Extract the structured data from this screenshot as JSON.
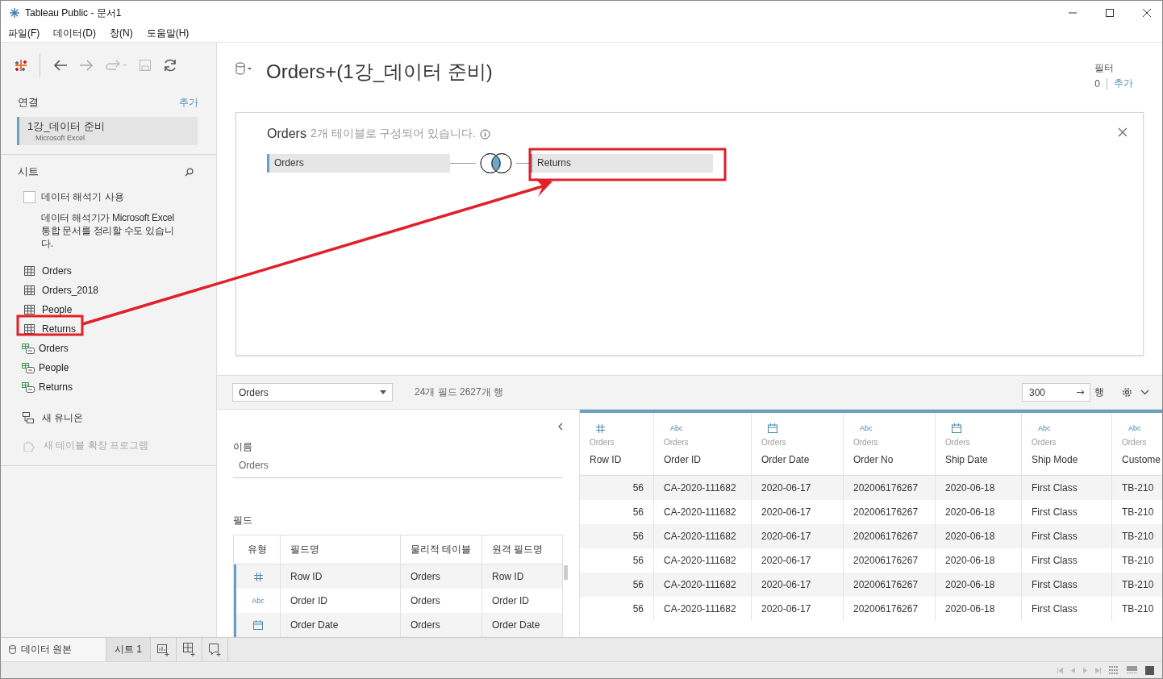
{
  "window": {
    "title": "Tableau Public - 문서1"
  },
  "menu": [
    "파일(F)",
    "데이터(D)",
    "창(N)",
    "도움말(H)"
  ],
  "sidebar": {
    "connections_label": "연결",
    "add_link": "추가",
    "connection": {
      "name": "1강_데이터 준비",
      "type": "Microsoft Excel",
      "selected": true
    },
    "sheets_label": "시트",
    "interpreter": {
      "label": "데이터 해석기 사용",
      "checked": false,
      "description": "데이터 해석기가 Microsoft Excel 통합 문서를 정리할 수도 있습니다."
    },
    "sheets": [
      {
        "name": "Orders",
        "kind": "table"
      },
      {
        "name": "Orders_2018",
        "kind": "table"
      },
      {
        "name": "People",
        "kind": "table"
      },
      {
        "name": "Returns",
        "kind": "table"
      },
      {
        "name": "Orders",
        "kind": "range"
      },
      {
        "name": "People",
        "kind": "range"
      },
      {
        "name": "Returns",
        "kind": "range"
      }
    ],
    "actions": [
      {
        "label": "새 유니온",
        "kind": "union",
        "disabled": false
      },
      {
        "label": "새 테이블 확장 프로그램",
        "kind": "extension",
        "disabled": true
      }
    ]
  },
  "datasource": {
    "title": "Orders+(1강_데이터 준비)",
    "filters_label": "필터",
    "filters_count": "0",
    "filters_add": "추가"
  },
  "canvas": {
    "table": "Orders",
    "summary": "2개 테이블로 구성되어 있습니다.",
    "tables": [
      {
        "name": "Orders"
      },
      {
        "name": "Returns"
      }
    ],
    "join": {
      "kind": "inner"
    }
  },
  "grid_toolbar": {
    "table": "Orders",
    "summary": "24개 필드 2627개 행",
    "rows_value": "300",
    "rows_unit": "행"
  },
  "metadata": {
    "name_label": "이름",
    "name_value": "Orders",
    "fields_label": "필드",
    "columns": [
      "유형",
      "필드명",
      "물리적 테이블",
      "원격 필드명"
    ],
    "rows": [
      {
        "kind": "number",
        "name": "Row ID",
        "table": "Orders",
        "remote": "Row ID"
      },
      {
        "kind": "string",
        "type_label": "Abc",
        "name": "Order ID",
        "table": "Orders",
        "remote": "Order ID"
      },
      {
        "kind": "date",
        "name": "Order Date",
        "table": "Orders",
        "remote": "Order Date"
      }
    ]
  },
  "grid": {
    "columns": [
      {
        "kind": "number",
        "source": "Orders",
        "name": "Row ID"
      },
      {
        "kind": "string",
        "type_label": "Abc",
        "source": "Orders",
        "name": "Order ID"
      },
      {
        "kind": "date",
        "source": "Orders",
        "name": "Order Date"
      },
      {
        "kind": "string",
        "type_label": "Abc",
        "source": "Orders",
        "name": "Order No"
      },
      {
        "kind": "date",
        "source": "Orders",
        "name": "Ship Date"
      },
      {
        "kind": "string",
        "type_label": "Abc",
        "source": "Orders",
        "name": "Ship Mode"
      },
      {
        "kind": "string",
        "type_label": "Abc",
        "source": "Orders",
        "name": "Custome"
      }
    ],
    "rows": [
      [
        "56",
        "CA-2020-111682",
        "2020-06-17",
        "202006176267",
        "2020-06-18",
        "First Class",
        "TB-210"
      ],
      [
        "56",
        "CA-2020-111682",
        "2020-06-17",
        "202006176267",
        "2020-06-18",
        "First Class",
        "TB-210"
      ],
      [
        "56",
        "CA-2020-111682",
        "2020-06-17",
        "202006176267",
        "2020-06-18",
        "First Class",
        "TB-210"
      ],
      [
        "56",
        "CA-2020-111682",
        "2020-06-17",
        "202006176267",
        "2020-06-18",
        "First Class",
        "TB-210"
      ],
      [
        "56",
        "CA-2020-111682",
        "2020-06-17",
        "202006176267",
        "2020-06-18",
        "First Class",
        "TB-210"
      ],
      [
        "56",
        "CA-2020-111682",
        "2020-06-17",
        "202006176267",
        "2020-06-18",
        "First Class",
        "TB-210"
      ]
    ]
  },
  "bottom_tabs": [
    {
      "label": "데이터 원본",
      "kind": "datasource",
      "selected": true
    },
    {
      "label": "시트 1",
      "kind": "sheet",
      "selected": false
    }
  ],
  "annotation": {
    "kind": "arrow-highlight"
  }
}
